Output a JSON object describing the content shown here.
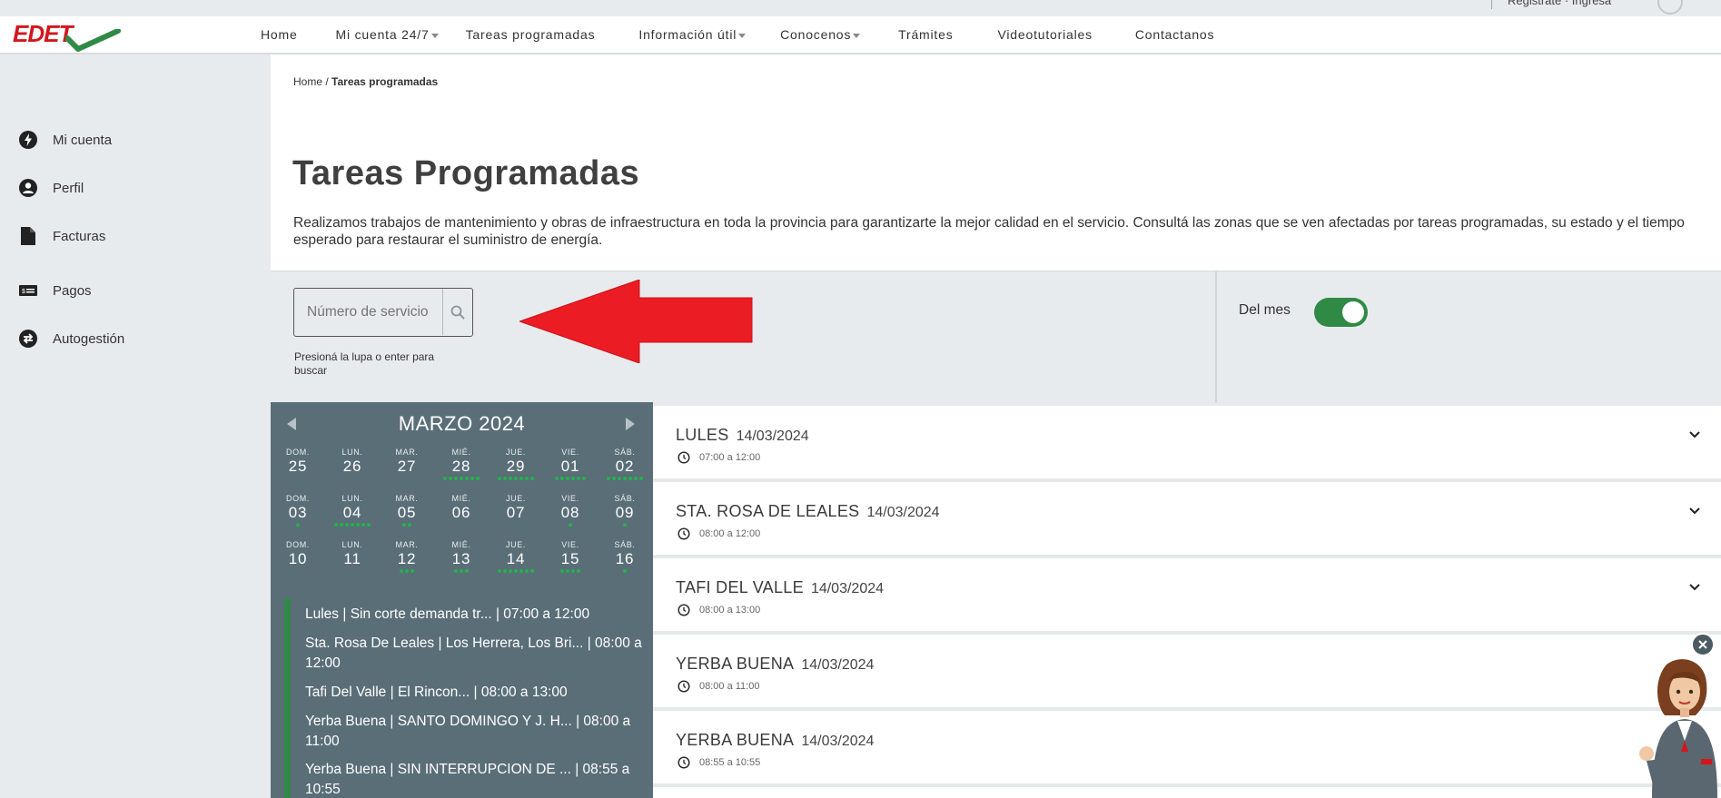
{
  "topbar": {
    "account_links": "Registrate · Ingresá"
  },
  "header": {
    "logo_text": "EDET",
    "nav": [
      {
        "label": "Home",
        "caret": false
      },
      {
        "label": "Mi cuenta 24/7",
        "caret": true
      },
      {
        "label": "Tareas programadas",
        "caret": false
      },
      {
        "label": "Información útil",
        "caret": true
      },
      {
        "label": "Conocenos",
        "caret": true
      },
      {
        "label": "Trámites",
        "caret": false
      },
      {
        "label": "Videotutoriales",
        "caret": false
      },
      {
        "label": "Contactanos",
        "caret": false
      }
    ]
  },
  "sidebar": {
    "items": [
      {
        "label": "Mi cuenta",
        "icon": "bolt-icon"
      },
      {
        "label": "Perfil",
        "icon": "user-icon"
      },
      {
        "label": "Facturas",
        "icon": "document-icon"
      },
      {
        "label": "Pagos",
        "icon": "payment-icon"
      },
      {
        "label": "Autogestión",
        "icon": "swap-icon"
      }
    ]
  },
  "breadcrumb": {
    "home": "Home",
    "separator": "/",
    "current": "Tareas programadas"
  },
  "page": {
    "title": "Tareas Programadas",
    "intro": "Realizamos trabajos de mantenimiento y obras de infraestructura en toda la provincia para garantizarte la mejor calidad en el servicio. Consultá las zonas que se ven afectadas por tareas programadas, su estado y el tiempo esperado para restaurar el suministro de energía."
  },
  "search": {
    "placeholder": "Número de servicio",
    "hint": "Presioná la lupa o enter para buscar"
  },
  "filter": {
    "toggle_label": "Del mes",
    "toggle_on": true
  },
  "colors": {
    "brand_red": "#d4151c",
    "brand_green": "#2e8a45",
    "calendar_bg": "#5a6e78",
    "annotation_arrow": "#ec1c24"
  },
  "calendar": {
    "month_title": "MARZO 2024",
    "weeks": [
      [
        {
          "dn": "DOM.",
          "num": "25",
          "dots": 0
        },
        {
          "dn": "LUN.",
          "num": "26",
          "dots": 0
        },
        {
          "dn": "MAR.",
          "num": "27",
          "dots": 0
        },
        {
          "dn": "MIÉ.",
          "num": "28",
          "dots": 7
        },
        {
          "dn": "JUE.",
          "num": "29",
          "dots": 7
        },
        {
          "dn": "VIE.",
          "num": "01",
          "dots": 6
        },
        {
          "dn": "SÁB.",
          "num": "02",
          "dots": 7
        }
      ],
      [
        {
          "dn": "DOM.",
          "num": "03",
          "dots": 1
        },
        {
          "dn": "LUN.",
          "num": "04",
          "dots": 7
        },
        {
          "dn": "MAR.",
          "num": "05",
          "dots": 2
        },
        {
          "dn": "MIÉ.",
          "num": "06",
          "dots": 0
        },
        {
          "dn": "JUE.",
          "num": "07",
          "dots": 0
        },
        {
          "dn": "VIE.",
          "num": "08",
          "dots": 1
        },
        {
          "dn": "SÁB.",
          "num": "09",
          "dots": 1
        }
      ],
      [
        {
          "dn": "DOM.",
          "num": "10",
          "dots": 0
        },
        {
          "dn": "LUN.",
          "num": "11",
          "dots": 0
        },
        {
          "dn": "MAR.",
          "num": "12",
          "dots": 3
        },
        {
          "dn": "MIÉ.",
          "num": "13",
          "dots": 3
        },
        {
          "dn": "JUE.",
          "num": "14",
          "dots": 7,
          "selected": true
        },
        {
          "dn": "VIE.",
          "num": "15",
          "dots": 4
        },
        {
          "dn": "SÁB.",
          "num": "16",
          "dots": 1
        }
      ]
    ]
  },
  "day_events": [
    "Lules | Sin corte demanda tr... | 07:00 a 12:00",
    "Sta. Rosa De Leales | Los Herrera, Los Bri... | 08:00 a 12:00",
    "Tafi Del Valle | El Rincon... | 08:00 a 13:00",
    "Yerba Buena | SANTO DOMINGO Y J. H... | 08:00 a 11:00",
    "Yerba Buena | SIN INTERRUPCION DE ... | 08:55 a 10:55"
  ],
  "tasks": [
    {
      "location": "LULES",
      "date": "14/03/2024",
      "time": "07:00 a 12:00"
    },
    {
      "location": "STA. ROSA DE LEALES",
      "date": "14/03/2024",
      "time": "08:00 a 12:00"
    },
    {
      "location": "TAFI DEL VALLE",
      "date": "14/03/2024",
      "time": "08:00 a 13:00"
    },
    {
      "location": "YERBA BUENA",
      "date": "14/03/2024",
      "time": "08:00 a 11:00"
    },
    {
      "location": "YERBA BUENA",
      "date": "14/03/2024",
      "time": "08:55 a 10:55"
    }
  ]
}
